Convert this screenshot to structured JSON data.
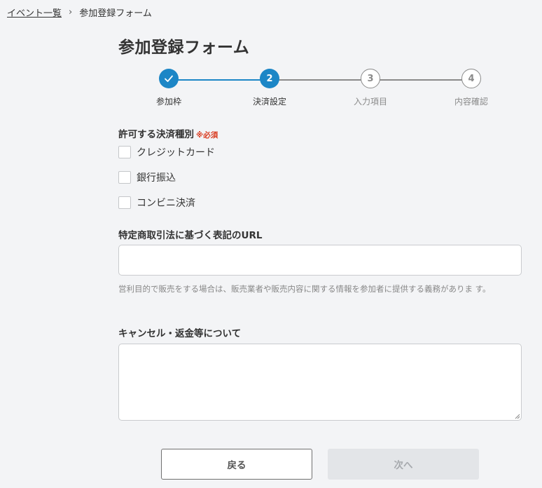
{
  "breadcrumb": {
    "link_label": "イベント一覧",
    "separator": "›",
    "current": "参加登録フォーム"
  },
  "page_title": "参加登録フォーム",
  "stepper": {
    "current_step": 2,
    "steps": [
      {
        "marker": "",
        "label": "参加枠",
        "state": "done"
      },
      {
        "marker": "2",
        "label": "決済設定",
        "state": "active"
      },
      {
        "marker": "3",
        "label": "入力項目",
        "state": "todo"
      },
      {
        "marker": "4",
        "label": "内容確認",
        "state": "todo"
      }
    ]
  },
  "payment_types": {
    "label": "許可する決済種別",
    "required_label": "※必須",
    "options": [
      {
        "label": "クレジットカード",
        "checked": false
      },
      {
        "label": "銀行振込",
        "checked": false
      },
      {
        "label": "コンビニ決済",
        "checked": false
      }
    ]
  },
  "tokusho_url": {
    "label": "特定商取引法に基づく表記のURL",
    "value": "",
    "help": "営利目的で販売をする場合は、販売業者や販売内容に関する情報を参加者に提供する義務がありま す。"
  },
  "cancel_policy": {
    "label": "キャンセル・返金等について",
    "value": ""
  },
  "buttons": {
    "back": "戻る",
    "next": "次へ"
  },
  "colors": {
    "accent": "#1c86c6",
    "required": "#d9391d",
    "disabled_bg": "#e3e5e8"
  }
}
